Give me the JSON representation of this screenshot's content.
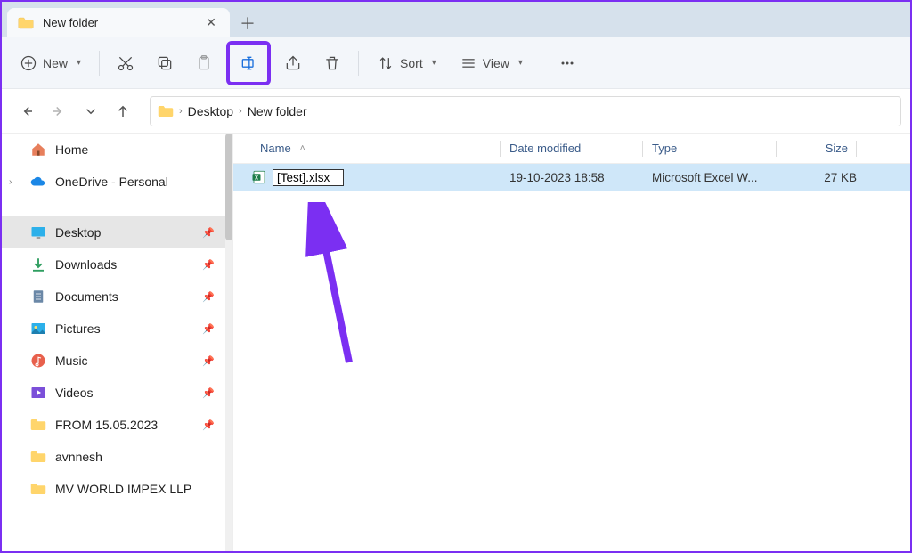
{
  "tab": {
    "title": "New folder"
  },
  "toolbar": {
    "new_label": "New",
    "sort_label": "Sort",
    "view_label": "View"
  },
  "breadcrumb": {
    "parts": [
      "Desktop",
      "New folder"
    ]
  },
  "sidebar": {
    "home": "Home",
    "onedrive": "OneDrive - Personal",
    "items": [
      {
        "label": "Desktop",
        "active": true,
        "pinned": true
      },
      {
        "label": "Downloads",
        "active": false,
        "pinned": true
      },
      {
        "label": "Documents",
        "active": false,
        "pinned": true
      },
      {
        "label": "Pictures",
        "active": false,
        "pinned": true
      },
      {
        "label": "Music",
        "active": false,
        "pinned": true
      },
      {
        "label": "Videos",
        "active": false,
        "pinned": true
      },
      {
        "label": "FROM 15.05.2023",
        "active": false,
        "pinned": true
      },
      {
        "label": "avnnesh",
        "active": false,
        "pinned": false
      },
      {
        "label": "MV WORLD IMPEX LLP",
        "active": false,
        "pinned": false
      }
    ]
  },
  "columns": {
    "name": "Name",
    "date": "Date modified",
    "type": "Type",
    "size": "Size"
  },
  "files": [
    {
      "name_edit": "[Test].xlsx",
      "date": "19-10-2023 18:58",
      "type": "Microsoft Excel W...",
      "size": "27 KB"
    }
  ]
}
